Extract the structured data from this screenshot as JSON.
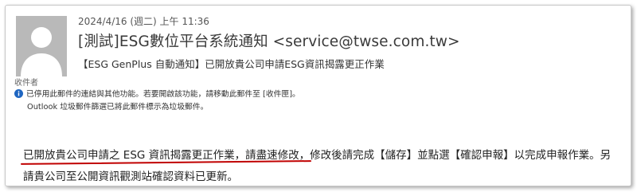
{
  "email": {
    "date": "2024/4/16 (週二) 上午 11:36",
    "sender": "[測試]ESG數位平台系統通知 <service@twse.com.tw>",
    "subject": "【ESG GenPlus 自動通知】已開放貴公司申請ESG資訊揭露更正作業",
    "recipients_label": "收件者",
    "notice": "已停用此郵件的連結與其他功能。若要開啟該功能，請移動此郵件至 [收件匣]。",
    "junk_notice": "Outlook 垃圾郵件篩選已將此郵件標示為垃圾郵件。",
    "body_line1_highlight": "已開放貴公司申請之 ESG 資訊揭露更正作業，請盡速修改",
    "body_line1_rest": "，修改後請完成【儲存】並點選【確認申報】以完成申報作業。另",
    "body_line2": "請貴公司至公開資訊觀測站確認資料已更新。"
  },
  "icons": {
    "avatar": "person-avatar-icon",
    "info": "info-icon"
  },
  "colors": {
    "avatar_bg": "#b9b9b9",
    "info_blue": "#1f66c1",
    "annotation_red": "#c00000"
  }
}
